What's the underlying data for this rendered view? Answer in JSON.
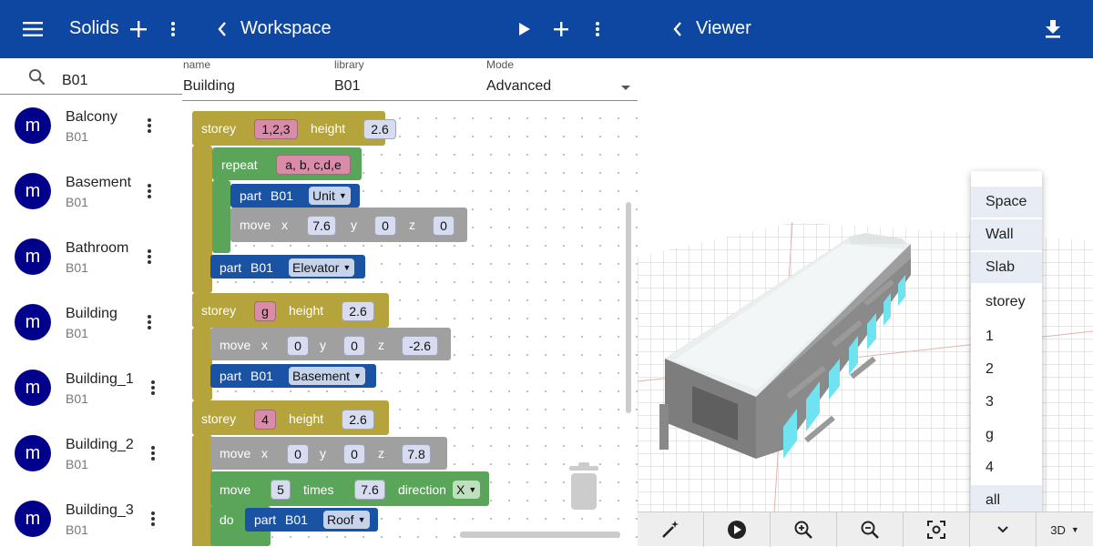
{
  "left": {
    "title": "Solids",
    "search_value": "B01",
    "items": [
      {
        "avatar": "m",
        "name": "Balcony",
        "lib": "B01"
      },
      {
        "avatar": "m",
        "name": "Basement",
        "lib": "B01"
      },
      {
        "avatar": "m",
        "name": "Bathroom",
        "lib": "B01"
      },
      {
        "avatar": "m",
        "name": "Building",
        "lib": "B01"
      },
      {
        "avatar": "m",
        "name": "Building_1",
        "lib": "B01"
      },
      {
        "avatar": "m",
        "name": "Building_2",
        "lib": "B01"
      },
      {
        "avatar": "m",
        "name": "Building_3",
        "lib": "B01"
      }
    ]
  },
  "workspace": {
    "title": "Workspace",
    "fields": {
      "name_label": "name",
      "name_value": "Building",
      "library_label": "library",
      "library_value": "B01",
      "mode_label": "Mode",
      "mode_value": "Advanced"
    },
    "blocks": {
      "s1_storey": "storey",
      "s1_val": "1,2,3",
      "s1_height": "height",
      "s1_hval": "2.6",
      "rep_label": "repeat",
      "rep_val": "a, b, c,d,e",
      "p1_part": "part",
      "p1_lib": "B01",
      "p1_name": "Unit",
      "m1_move": "move",
      "m1_x": "x",
      "m1_xv": "7.6",
      "m1_y": "y",
      "m1_yv": "0",
      "m1_z": "z",
      "m1_zv": "0",
      "p2_part": "part",
      "p2_lib": "B01",
      "p2_name": "Elevator",
      "s2_storey": "storey",
      "s2_val": "g",
      "s2_height": "height",
      "s2_hval": "2.6",
      "m2_move": "move",
      "m2_x": "x",
      "m2_xv": "0",
      "m2_y": "y",
      "m2_yv": "0",
      "m2_z": "z",
      "m2_zv": "-2.6",
      "p3_part": "part",
      "p3_lib": "B01",
      "p3_name": "Basement",
      "s3_storey": "storey",
      "s3_val": "4",
      "s3_height": "height",
      "s3_hval": "2.6",
      "m3_move": "move",
      "m3_x": "x",
      "m3_xv": "0",
      "m3_y": "y",
      "m3_yv": "0",
      "m3_z": "z",
      "m3_zv": "7.8",
      "m4_move": "move",
      "m4_times_val": "5",
      "m4_times": "times",
      "m4_dist": "7.6",
      "m4_dir": "direction",
      "m4_dir_val": "X",
      "do_label": "do",
      "p4_part": "part",
      "p4_lib": "B01",
      "p4_name": "Roof"
    }
  },
  "viewer": {
    "title": "Viewer",
    "view_mode": "3D",
    "layer_options": [
      "Space",
      "Wall",
      "Slab",
      "storey",
      "1",
      "2",
      "3",
      "g",
      "4",
      "all"
    ]
  },
  "colors": {
    "appbar": "#0d47a1",
    "avatar": "#00008b",
    "storey": "#b5a33b",
    "repeat": "#5ba55b",
    "part": "#1a53a3",
    "move": "#a0a0a0"
  }
}
